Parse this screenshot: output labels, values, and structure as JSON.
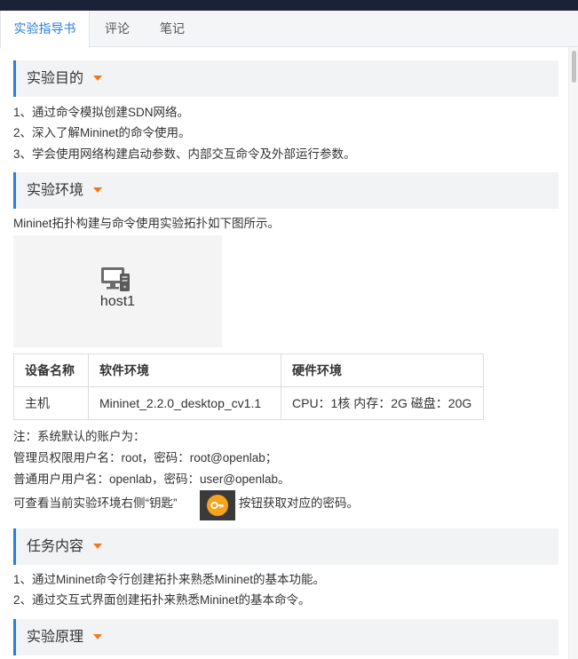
{
  "tabs": [
    "实验指导书",
    "评论",
    "笔记"
  ],
  "sections": {
    "purpose": "实验目的",
    "environment": "实验环境",
    "tasks": "任务内容",
    "principle": "实验原理"
  },
  "purpose_items": [
    "1、通过命令模拟创建SDN网络。",
    "2、深入了解Mininet的命令使用。",
    "3、学会使用网络构建启动参数、内部交互命令及外部运行参数。"
  ],
  "environment": {
    "intro": "Mininet拓扑构建与命令使用实验拓扑如下图所示。",
    "topology": {
      "host_label": "host1",
      "icon": "computer-icon"
    },
    "table": {
      "headers": [
        "设备名称",
        "软件环境",
        "硬件环境"
      ],
      "rows": [
        [
          "主机",
          "Mininet_2.2.0_desktop_cv1.1",
          "CPU：1核 内存：2G 磁盘：20G"
        ]
      ]
    },
    "notes": [
      "注：系统默认的账户为：",
      "管理员权限用户名：root，密码：root@openlab；",
      "普通用户用户名：openlab，密码：user@openlab。"
    ],
    "key_hint_before": "可查看当前实验环境右侧“钥匙”",
    "key_hint_after": "按钮获取对应的密码。",
    "key_icon": "key-icon"
  },
  "task_items": [
    "1、通过Mininet命令行创建拓扑来熟悉Mininet的基本功能。",
    "2、通过交互式界面创建拓扑来熟悉Mininet的基本命令。"
  ],
  "colors": {
    "accent": "#2a7ddc",
    "caret": "#f07a1e",
    "topbar": "#1b2238",
    "key_button": "#3a3a3a",
    "key_circle": "#f5a41c"
  }
}
